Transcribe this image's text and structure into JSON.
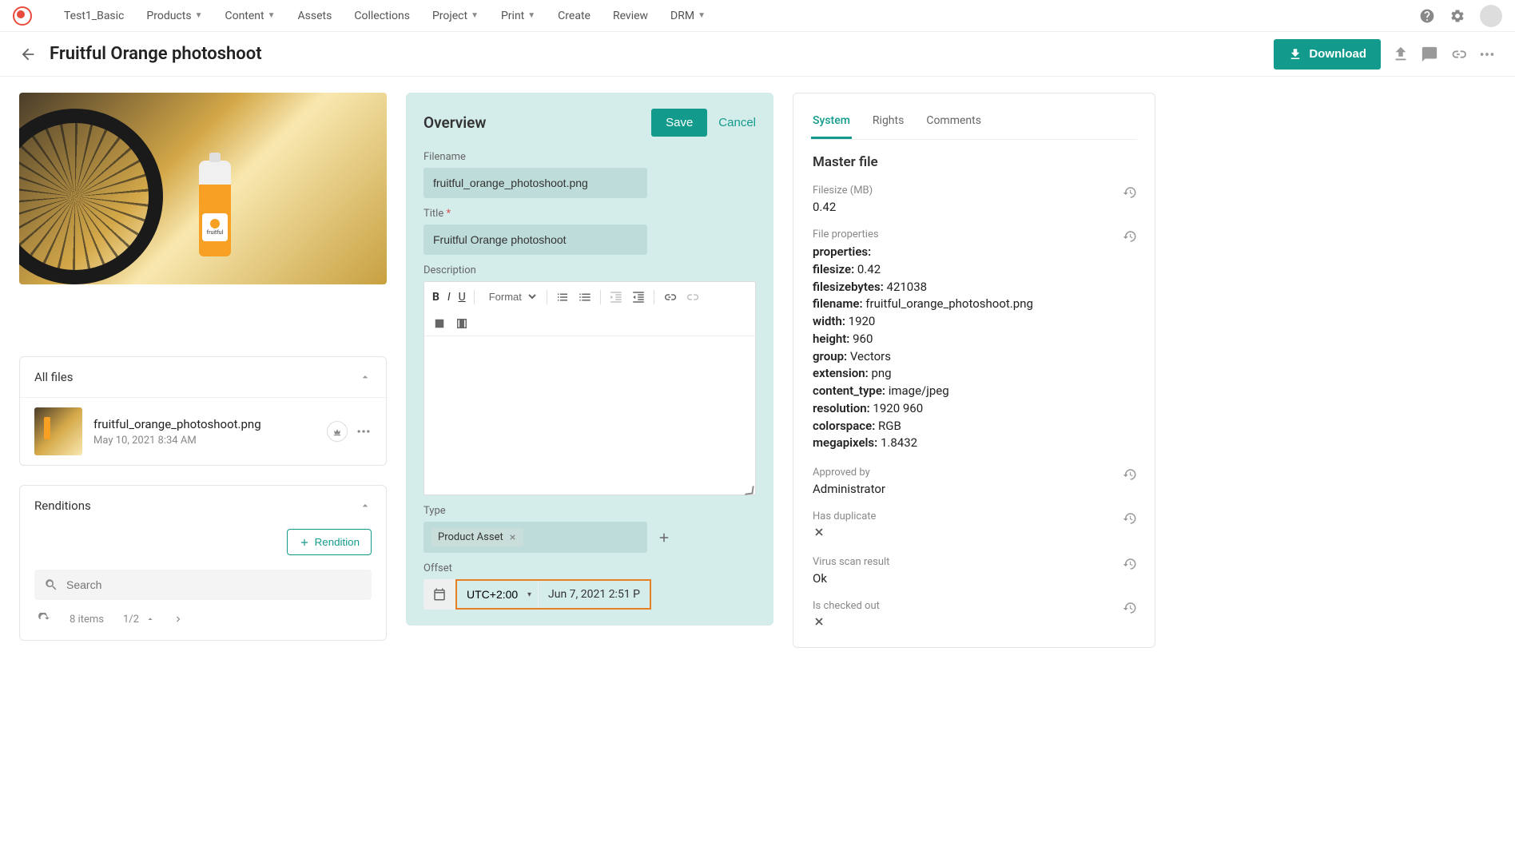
{
  "nav": {
    "items": [
      "Test1_Basic",
      "Products",
      "Content",
      "Assets",
      "Collections",
      "Project",
      "Print",
      "Create",
      "Review",
      "DRM"
    ],
    "dropdowns": [
      false,
      true,
      true,
      false,
      false,
      true,
      true,
      false,
      false,
      true
    ]
  },
  "header": {
    "title": "Fruitful Orange photoshoot",
    "download": "Download"
  },
  "allfiles": {
    "title": "All files",
    "filename": "fruitful_orange_photoshoot.png",
    "date": "May 10, 2021 8:34 AM"
  },
  "renditions": {
    "title": "Renditions",
    "button": "Rendition",
    "search_placeholder": "Search",
    "count": "8 items",
    "pager": "1/2"
  },
  "overview": {
    "title": "Overview",
    "save": "Save",
    "cancel": "Cancel",
    "filename_label": "Filename",
    "filename_value": "fruitful_orange_photoshoot.png",
    "title_label": "Title",
    "title_value": "Fruitful Orange photoshoot",
    "description_label": "Description",
    "format_label": "Format",
    "type_label": "Type",
    "type_tag": "Product Asset",
    "offset_label": "Offset",
    "tz": "UTC+2:00",
    "offset_value": "Jun 7, 2021 2:51 P"
  },
  "rightpanel": {
    "tabs": [
      "System",
      "Rights",
      "Comments"
    ],
    "master_file": "Master file",
    "filesize_label": "Filesize (MB)",
    "filesize_value": "0.42",
    "fileprops_label": "File properties",
    "props": {
      "properties": "",
      "filesize": "0.42",
      "filesizebytes": "421038",
      "filename": "fruitful_orange_photoshoot.png",
      "width": "1920",
      "height": "960",
      "group": "Vectors",
      "extension": "png",
      "content_type": "image/jpeg",
      "resolution": "1920 960",
      "colorspace": "RGB",
      "megapixels": "1.8432"
    },
    "approved_label": "Approved by",
    "approved_value": "Administrator",
    "duplicate_label": "Has duplicate",
    "virus_label": "Virus scan result",
    "virus_value": "Ok",
    "checkedout_label": "Is checked out"
  }
}
